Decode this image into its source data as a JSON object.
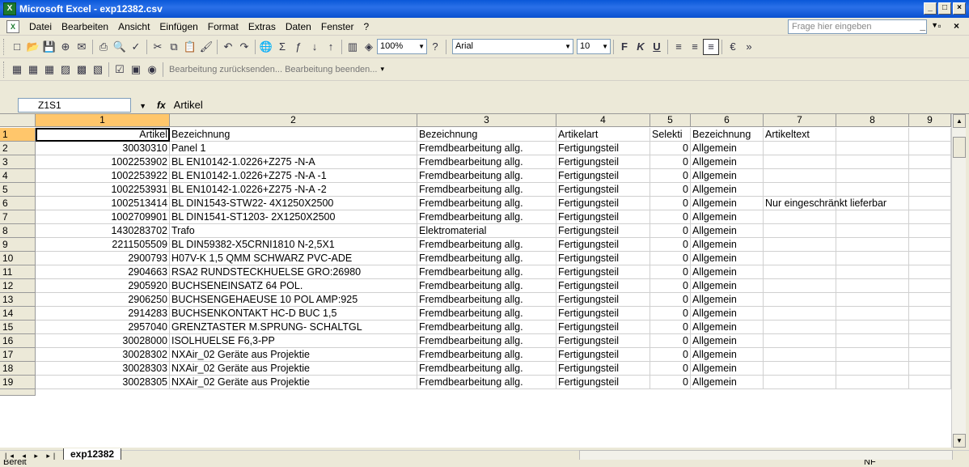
{
  "window": {
    "title": "Microsoft Excel - exp12382.csv",
    "app_icon": "X"
  },
  "menu": [
    "Datei",
    "Bearbeiten",
    "Ansicht",
    "Einfügen",
    "Format",
    "Extras",
    "Daten",
    "Fenster",
    "?"
  ],
  "help_placeholder": "Frage hier eingeben",
  "toolbar": {
    "zoom": "100%",
    "font": "Arial",
    "size": "10",
    "bold": "F",
    "italic": "K",
    "underline": "U",
    "euro": "€"
  },
  "toolbar2": {
    "review_text": "Bearbeitung zurücksenden... Bearbeitung beenden..."
  },
  "formula": {
    "namebox": "Z1S1",
    "fx": "fx",
    "content": "Artikel"
  },
  "columns": [
    "1",
    "2",
    "3",
    "4",
    "5",
    "6",
    "7",
    "8",
    "9"
  ],
  "rows": [
    {
      "n": "1",
      "c1": "Artikel",
      "c2": "Bezeichnung",
      "c3": "Bezeichnung",
      "c4": "Artikelart",
      "c5": "Selekti",
      "c6": "Bezeichnung",
      "c7": "Artikeltext"
    },
    {
      "n": "2",
      "c1": "30030310",
      "c2": "Panel 1",
      "c3": "Fremdbearbeitung allg.",
      "c4": "Fertigungsteil",
      "c5": "0",
      "c6": "Allgemein",
      "c7": ""
    },
    {
      "n": "3",
      "c1": "1002253902",
      "c2": "BL EN10142-1.0226+Z275 -N-A",
      "c3": "Fremdbearbeitung allg.",
      "c4": "Fertigungsteil",
      "c5": "0",
      "c6": "Allgemein",
      "c7": ""
    },
    {
      "n": "4",
      "c1": "1002253922",
      "c2": "BL EN10142-1.0226+Z275 -N-A -1",
      "c3": "Fremdbearbeitung allg.",
      "c4": "Fertigungsteil",
      "c5": "0",
      "c6": "Allgemein",
      "c7": ""
    },
    {
      "n": "5",
      "c1": "1002253931",
      "c2": "BL EN10142-1.0226+Z275 -N-A -2",
      "c3": "Fremdbearbeitung allg.",
      "c4": "Fertigungsteil",
      "c5": "0",
      "c6": "Allgemein",
      "c7": ""
    },
    {
      "n": "6",
      "c1": "1002513414",
      "c2": "BL DIN1543-STW22- 4X1250X2500",
      "c3": "Fremdbearbeitung allg.",
      "c4": "Fertigungsteil",
      "c5": "0",
      "c6": "Allgemein",
      "c7": "Nur eingeschränkt lieferbar"
    },
    {
      "n": "7",
      "c1": "1002709901",
      "c2": "BL DIN1541-ST1203- 2X1250X2500",
      "c3": "Fremdbearbeitung allg.",
      "c4": "Fertigungsteil",
      "c5": "0",
      "c6": "Allgemein",
      "c7": ""
    },
    {
      "n": "8",
      "c1": "1430283702",
      "c2": "Trafo",
      "c3": "Elektromaterial",
      "c4": "Fertigungsteil",
      "c5": "0",
      "c6": "Allgemein",
      "c7": ""
    },
    {
      "n": "9",
      "c1": "2211505509",
      "c2": "BL DIN59382-X5CRNI1810 N-2,5X1",
      "c3": "Fremdbearbeitung allg.",
      "c4": "Fertigungsteil",
      "c5": "0",
      "c6": "Allgemein",
      "c7": ""
    },
    {
      "n": "10",
      "c1": "2900793",
      "c2": "H07V-K 1,5 QMM SCHWARZ PVC-ADE",
      "c3": "Fremdbearbeitung allg.",
      "c4": "Fertigungsteil",
      "c5": "0",
      "c6": "Allgemein",
      "c7": ""
    },
    {
      "n": "11",
      "c1": "2904663",
      "c2": "RSA2 RUNDSTECKHUELSE GRO:26980",
      "c3": "Fremdbearbeitung allg.",
      "c4": "Fertigungsteil",
      "c5": "0",
      "c6": "Allgemein",
      "c7": ""
    },
    {
      "n": "12",
      "c1": "2905920",
      "c2": "BUCHSENEINSATZ 64 POL.",
      "c3": "Fremdbearbeitung allg.",
      "c4": "Fertigungsteil",
      "c5": "0",
      "c6": "Allgemein",
      "c7": ""
    },
    {
      "n": "13",
      "c1": "2906250",
      "c2": "BUCHSENGEHAEUSE 10 POL AMP:925",
      "c3": "Fremdbearbeitung allg.",
      "c4": "Fertigungsteil",
      "c5": "0",
      "c6": "Allgemein",
      "c7": ""
    },
    {
      "n": "14",
      "c1": "2914283",
      "c2": "BUCHSENKONTAKT HC-D BUC 1,5",
      "c3": "Fremdbearbeitung allg.",
      "c4": "Fertigungsteil",
      "c5": "0",
      "c6": "Allgemein",
      "c7": ""
    },
    {
      "n": "15",
      "c1": "2957040",
      "c2": "GRENZTASTER M.SPRUNG- SCHALTGL",
      "c3": "Fremdbearbeitung allg.",
      "c4": "Fertigungsteil",
      "c5": "0",
      "c6": "Allgemein",
      "c7": ""
    },
    {
      "n": "16",
      "c1": "30028000",
      "c2": "ISOLHUELSE F6,3-PP",
      "c3": "Fremdbearbeitung allg.",
      "c4": "Fertigungsteil",
      "c5": "0",
      "c6": "Allgemein",
      "c7": ""
    },
    {
      "n": "17",
      "c1": "30028302",
      "c2": "NXAir_02  Geräte aus Projektie",
      "c3": "Fremdbearbeitung allg.",
      "c4": "Fertigungsteil",
      "c5": "0",
      "c6": "Allgemein",
      "c7": ""
    },
    {
      "n": "18",
      "c1": "30028303",
      "c2": "NXAir_02  Geräte aus Projektie",
      "c3": "Fremdbearbeitung allg.",
      "c4": "Fertigungsteil",
      "c5": "0",
      "c6": "Allgemein",
      "c7": ""
    },
    {
      "n": "19",
      "c1": "30028305",
      "c2": "NXAir_02  Geräte aus Projektie",
      "c3": "Fremdbearbeitung allg.",
      "c4": "Fertigungsteil",
      "c5": "0",
      "c6": "Allgemein",
      "c7": ""
    }
  ],
  "sheet_tab": "exp12382",
  "status": {
    "left": "Bereit",
    "right": "NF"
  }
}
